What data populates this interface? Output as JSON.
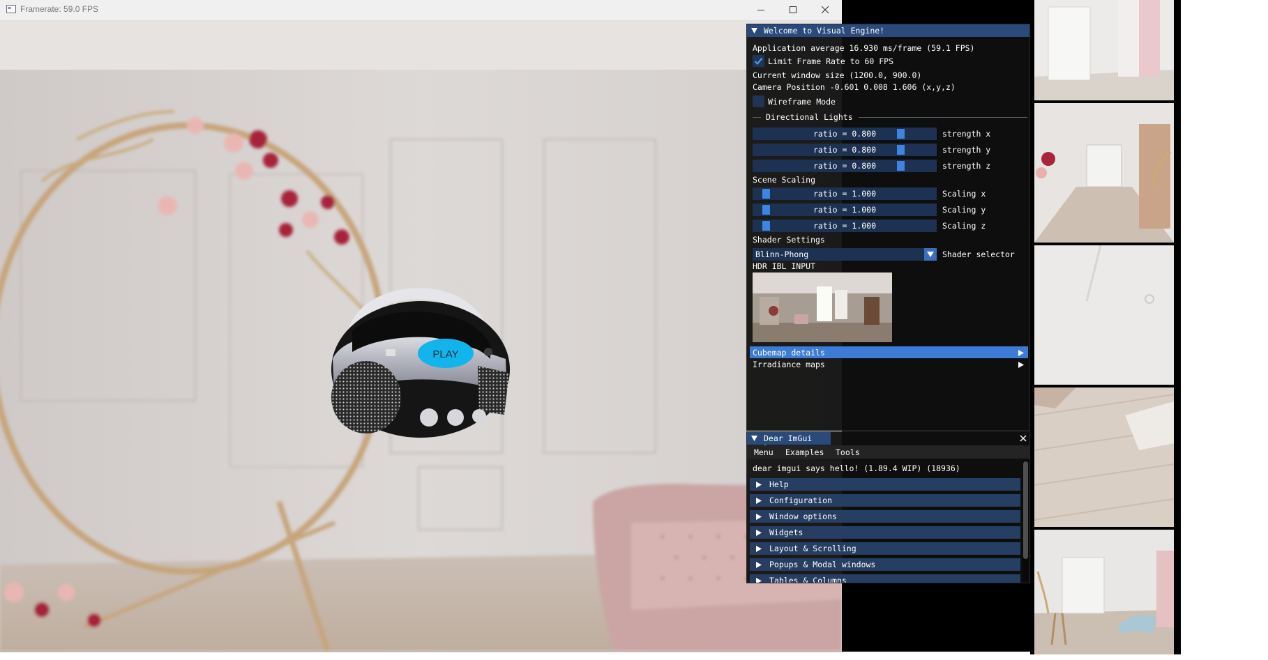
{
  "window": {
    "title": "Framerate: 59.0 FPS",
    "controls": {
      "minimize": "minimize",
      "maximize": "maximize",
      "close": "close"
    }
  },
  "viewport": {
    "model_button_label": "PLAY",
    "accent_color": "#12b4ec"
  },
  "visual_engine": {
    "title": "Welcome to Visual Engine!",
    "app_average": "Application average 16.930 ms/frame (59.1 FPS)",
    "limit_frame_rate": {
      "label": "Limit Frame Rate to 60 FPS",
      "checked": true
    },
    "window_size": "Current window size (1200.0, 900.0)",
    "camera_position": "Camera Position -0.601 0.008 1.606 (x,y,z)",
    "wireframe": {
      "label": "Wireframe Mode",
      "checked": false
    },
    "directional_lights_header": "Directional Lights",
    "light_sliders": [
      {
        "text": "ratio = 0.800",
        "label": "strength x",
        "value": 0.8
      },
      {
        "text": "ratio = 0.800",
        "label": "strength y",
        "value": 0.8
      },
      {
        "text": "ratio = 0.800",
        "label": "strength z",
        "value": 0.8
      }
    ],
    "scene_scaling_header": "Scene Scaling",
    "scale_sliders": [
      {
        "text": "ratio = 1.000",
        "label": "Scaling x",
        "value": 1.0
      },
      {
        "text": "ratio = 1.000",
        "label": "Scaling y",
        "value": 1.0
      },
      {
        "text": "ratio = 1.000",
        "label": "Scaling z",
        "value": 1.0
      }
    ],
    "shader_settings_header": "Shader Settings",
    "shader_combo": {
      "value": "Blinn-Phong",
      "label": "Shader selector"
    },
    "hdr_ibl_label": "HDR IBL INPUT",
    "tree_nodes": [
      {
        "label": "Cubemap details",
        "selected": true
      },
      {
        "label": "Irradiance maps",
        "selected": false
      }
    ]
  },
  "imgui_demo": {
    "title": "Dear ImGui Demo",
    "menu": [
      "Menu",
      "Examples",
      "Tools"
    ],
    "hello": "dear imgui says hello! (1.89.4 WIP) (18936)",
    "headers": [
      "Help",
      "Configuration",
      "Window options",
      "Widgets",
      "Layout & Scrolling",
      "Popups & Modal windows",
      "Tables & Columns"
    ]
  },
  "cubemap_faces": [
    "cubemap-face-1",
    "cubemap-face-2",
    "cubemap-face-3",
    "cubemap-face-4",
    "cubemap-face-5"
  ],
  "colors": {
    "imgui_title": "#294a7a",
    "imgui_frame": "#1d3252",
    "imgui_grab": "#3d85e0",
    "imgui_selected": "#3c7bd6"
  }
}
